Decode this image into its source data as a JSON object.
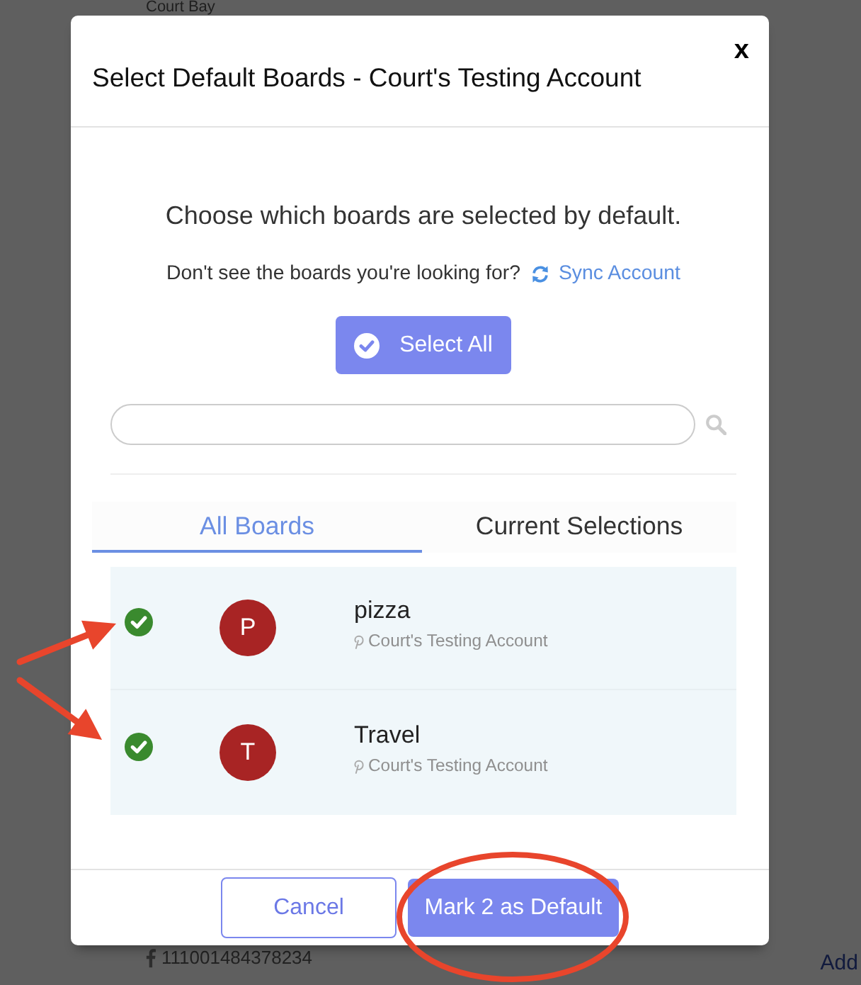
{
  "background": {
    "heading": "Court Bay",
    "account_id": "111001484378234",
    "link": "Add"
  },
  "dialog": {
    "title": "Select Default Boards - Court's Testing Account",
    "close": "x",
    "prompt": "Choose which boards are selected by default.",
    "hint": "Don't see the boards you're looking for?",
    "sync_link": "Sync Account",
    "select_all": "Select All",
    "tabs": [
      {
        "label": "All Boards",
        "selected": true
      },
      {
        "label": "Current Selections",
        "selected": false
      }
    ],
    "boards": [
      {
        "name": "pizza",
        "initial": "P",
        "account": "Court's Testing Account",
        "checked": true
      },
      {
        "name": "Travel",
        "initial": "T",
        "account": "Court's Testing Account",
        "checked": true
      }
    ],
    "buttons": [
      {
        "kind": "secondary",
        "label": "Cancel"
      },
      {
        "kind": "primary",
        "label": "Mark 2 as Default"
      }
    ]
  },
  "annotations": [
    {
      "kind": "arrow"
    },
    {
      "kind": "arrow"
    },
    {
      "kind": "ellipse"
    }
  ]
}
